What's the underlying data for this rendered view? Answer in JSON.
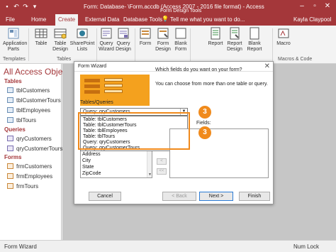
{
  "app": {
    "title": "Form: Database- \\Form.accdb (Access 2007 - 2016 file format) - Access",
    "context_tab_group": "Form Design Tools",
    "user": "Kayla Claypool",
    "tell_me": "Tell me what you want to do..."
  },
  "tabs": [
    {
      "label": "File"
    },
    {
      "label": "Home"
    },
    {
      "label": "Create"
    },
    {
      "label": "External Data"
    },
    {
      "label": "Database Tools"
    }
  ],
  "ribbon": {
    "buttons": [
      {
        "line1": "Application",
        "line2": "Parts",
        "icon": "application-parts-icon"
      },
      {
        "line1": "Table",
        "line2": "",
        "icon": "table-icon"
      },
      {
        "line1": "Table",
        "line2": "Design",
        "icon": "table-design-icon"
      },
      {
        "line1": "SharePoint",
        "line2": "Lists",
        "icon": "sharepoint-icon"
      },
      {
        "line1": "Query",
        "line2": "Wizard",
        "icon": "query-wizard-icon"
      },
      {
        "line1": "Query",
        "line2": "Design",
        "icon": "query-design-icon"
      },
      {
        "line1": "Form",
        "line2": "",
        "icon": "form-icon"
      },
      {
        "line1": "Form",
        "line2": "Design",
        "icon": "form-design-icon"
      },
      {
        "line1": "Blank",
        "line2": "Form",
        "icon": "blank-form-icon"
      },
      {
        "line1": "Report",
        "line2": "",
        "icon": "report-icon"
      },
      {
        "line1": "Report",
        "line2": "Design",
        "icon": "report-design-icon"
      },
      {
        "line1": "Blank",
        "line2": "Report",
        "icon": "blank-report-icon"
      },
      {
        "line1": "Macro",
        "line2": "",
        "icon": "macro-icon"
      }
    ],
    "groups": {
      "templates": "Templates",
      "tables": "Tables",
      "macros": "Macros & Code"
    }
  },
  "nav": {
    "title": "All Access Obje...",
    "sections": [
      {
        "name": "Tables",
        "items": [
          "tblCustomers",
          "tblCustomerTours",
          "tblEmployees",
          "tblTours"
        ]
      },
      {
        "name": "Queries",
        "items": [
          "qryCustomers",
          "qryCustomerTours"
        ]
      },
      {
        "name": "Forms",
        "items": [
          "frmCustomers",
          "frmEmployees",
          "frmTours"
        ]
      }
    ]
  },
  "wizard": {
    "title": "Form Wizard",
    "prompt1": "Which fields do you want on your form?",
    "prompt2": "You can choose from more than one table or query.",
    "tables_label": "Tables/Queries",
    "selected_source": "Query: qryCustomers",
    "dropdown_options": [
      "Table: tblCustomers",
      "Table: tblCustomerTours",
      "Table: tblEmployees",
      "Table: tblTours",
      "Query: qryCustomers",
      "Query: qryCustomerTours"
    ],
    "available_fields": [
      "Address",
      "City",
      "State",
      "ZipCode"
    ],
    "selected_fields_label": "Fields:",
    "buttons": {
      "cancel": "Cancel",
      "back": "< Back",
      "next": "Next >",
      "finish": "Finish"
    }
  },
  "callouts": [
    "3",
    "3"
  ],
  "status": {
    "left": "Form Wizard",
    "right": "Num Lock"
  },
  "colors": {
    "accent": "#a4373a",
    "callout": "#f08a1c"
  }
}
